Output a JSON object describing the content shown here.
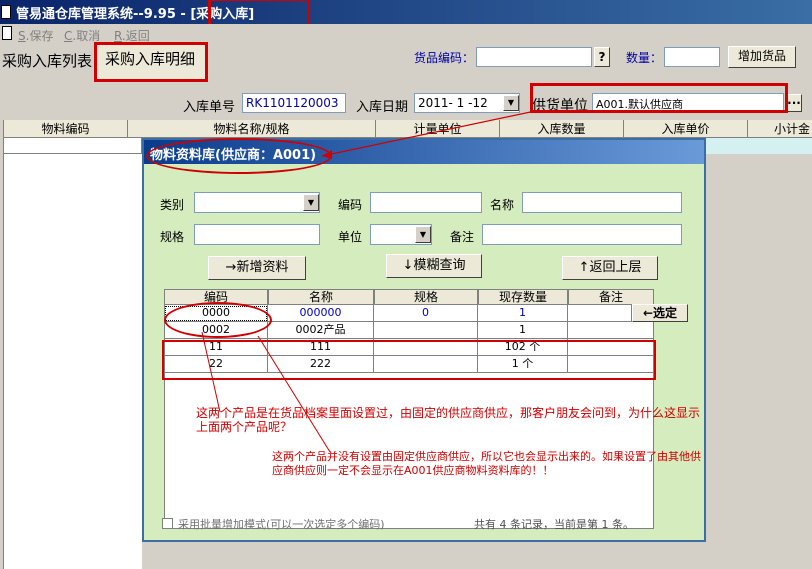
{
  "window": {
    "title": "管易通仓库管理系统--9.95 - [采购入库]"
  },
  "toolbar": {
    "save": {
      "key": "S",
      "label": ".保存"
    },
    "cancel": {
      "key": "C",
      "label": ".取消"
    },
    "back": {
      "key": "R",
      "label": ".返回"
    }
  },
  "tabs": {
    "list": "采购入库列表",
    "detail": "采购入库明细"
  },
  "search": {
    "code_label": "货品编码：",
    "code_value": "",
    "help_btn": "?",
    "qty_label": "数量：",
    "qty_value": "",
    "add_btn": "增加货品"
  },
  "form": {
    "order_no_label": "入库单号",
    "order_no": "RK1101120003",
    "date_label": "入库日期",
    "date": "2011- 1 -12",
    "supplier_label": "供货单位",
    "supplier": "A001.默认供应商",
    "ellipsis": "..."
  },
  "main_grid": {
    "columns": [
      "物料编码",
      "物料名称/规格",
      "计量单位",
      "入库数量",
      "入库单价",
      "小计金"
    ]
  },
  "dialog": {
    "title": "物料资料库(供应商：A001)",
    "fields": {
      "category": "类别",
      "code": "编码",
      "name": "名称",
      "spec": "规格",
      "unit": "单位",
      "remark": "备注"
    },
    "buttons": {
      "new": "→新增资料",
      "fuzzy": "↓模糊查询",
      "back": "↑返回上层",
      "select": "←选定"
    },
    "table": {
      "headers": [
        "编码",
        "名称",
        "规格",
        "现存数量",
        "备注"
      ],
      "rows": [
        [
          "0000",
          "000000",
          "0",
          "1",
          ""
        ],
        [
          "0002",
          "0002产品",
          "",
          "1",
          ""
        ],
        [
          "11",
          "111",
          "",
          "102 个",
          ""
        ],
        [
          "22",
          "222",
          "",
          "1 个",
          ""
        ]
      ]
    },
    "annotation1": "这两个产品是在货品档案里面设置过，由固定的供应商供应，那客户朋友会问到，为什么这显示上面两个产品呢？",
    "annotation2": "这两个产品并没有设置由固定供应商供应，所以它也会显示出来的。如果设置了由其他供应商供应则一定不会显示在A001供应商物料资料库的！！",
    "batch_mode": "采用批量增加模式(可以一次选定多个编码)",
    "status": "共有 4 条记录，当前是第 1 条。"
  }
}
